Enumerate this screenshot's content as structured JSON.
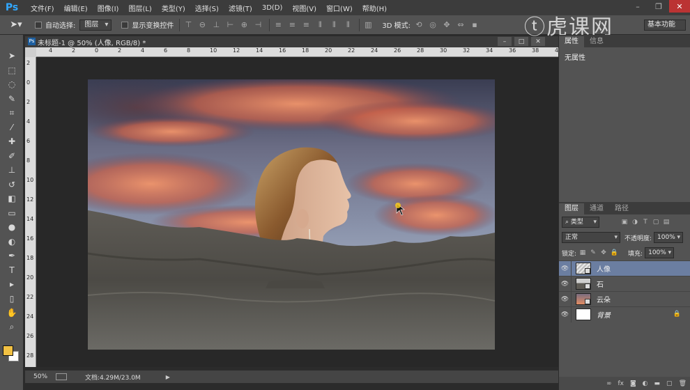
{
  "app": {
    "logo": "Ps",
    "menu": [
      "文件(F)",
      "编辑(E)",
      "图像(I)",
      "图层(L)",
      "类型(Y)",
      "选择(S)",
      "滤镜(T)",
      "3D(D)",
      "视图(V)",
      "窗口(W)",
      "帮助(H)"
    ],
    "watermark": "虎课网"
  },
  "options": {
    "auto_select_label": "自动选择:",
    "auto_select_value": "图层",
    "show_transform_label": "显示变换控件",
    "mode_3d_label": "3D 模式:",
    "workspace_value": "基本功能"
  },
  "document": {
    "tab_title": "未标题-1 @ 50% (人像, RGB/8) *",
    "ruler_top": [
      "4",
      "2",
      "0",
      "2",
      "4",
      "6",
      "8",
      "10",
      "12",
      "14",
      "16",
      "18",
      "20",
      "22",
      "24",
      "26",
      "28",
      "30",
      "32",
      "34",
      "36",
      "38",
      "40"
    ],
    "ruler_left": [
      "2",
      "0",
      "2",
      "4",
      "6",
      "8",
      "10",
      "12",
      "14",
      "16",
      "18",
      "20",
      "22",
      "24",
      "26",
      "28"
    ]
  },
  "status": {
    "zoom": "50%",
    "doc_info": "文档:4.29M/23.0M"
  },
  "properties": {
    "tabs": [
      "属性",
      "信息"
    ],
    "body_text": "无属性"
  },
  "layers": {
    "tabs": [
      "图层",
      "通道",
      "路径"
    ],
    "filter_value": "类型",
    "blend_mode": "正常",
    "opacity_label": "不透明度:",
    "opacity_value": "100%",
    "lock_label": "锁定:",
    "fill_label": "填充:",
    "fill_value": "100%",
    "items": [
      {
        "name": "人像",
        "selected": true
      },
      {
        "name": "石",
        "selected": false
      },
      {
        "name": "云朵",
        "selected": false
      },
      {
        "name": "背景",
        "selected": false
      }
    ]
  },
  "colors": {
    "foreground": "#f2c143",
    "background": "#ffffff",
    "selection": "#6b7ea1"
  }
}
